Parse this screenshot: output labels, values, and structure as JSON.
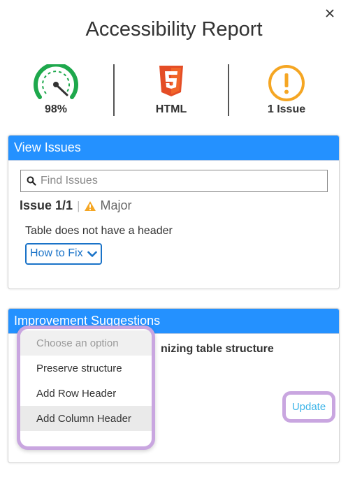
{
  "title": "Accessibility Report",
  "summary": {
    "score": "98%",
    "format": "HTML",
    "issues": "1 Issue",
    "score_value": 98,
    "colors": {
      "score": "#1ea84c",
      "html": "#e44d26",
      "issue": "#f5a623"
    }
  },
  "view_issues": {
    "header": "View Issues",
    "search_placeholder": "Find Issues",
    "issue_count": "Issue 1/1",
    "separator": "|",
    "severity": "Major",
    "description": "Table does not have a header",
    "how_to_fix": "How to Fix"
  },
  "improvement": {
    "header": "Improvement Suggestions",
    "suggestion": "nizing table structure",
    "update_label": "Update"
  },
  "dropdown": {
    "options": [
      {
        "label": "Choose an option",
        "state": "disabled"
      },
      {
        "label": "Preserve structure",
        "state": "normal"
      },
      {
        "label": "Add Row Header",
        "state": "normal"
      },
      {
        "label": "Add Column Header",
        "state": "hover"
      }
    ]
  },
  "colors": {
    "accent": "#2491ff",
    "highlight": "#c9a6e0",
    "link": "#1a73c8"
  }
}
